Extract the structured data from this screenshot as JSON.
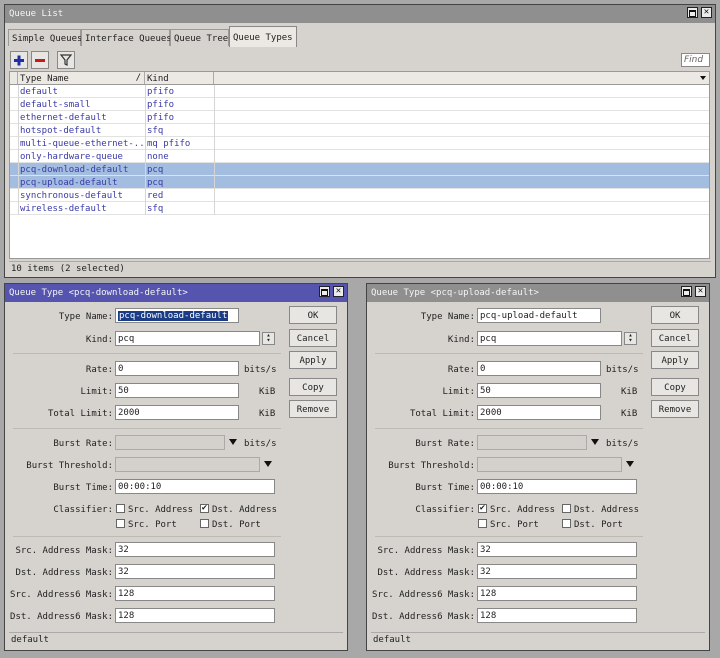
{
  "main": {
    "title": "Queue List",
    "tabs": [
      {
        "label": "Simple Queues"
      },
      {
        "label": "Interface Queues"
      },
      {
        "label": "Queue Tree"
      },
      {
        "label": "Queue Types"
      }
    ],
    "toolbar": {
      "add_icon": "plus-icon",
      "remove_icon": "minus-icon",
      "filter_icon": "filter-icon",
      "find_label": "Find"
    },
    "columns": {
      "name": "Type Name",
      "kind": "Kind"
    },
    "rows": [
      {
        "name": "default",
        "kind": "pfifo"
      },
      {
        "name": "default-small",
        "kind": "pfifo"
      },
      {
        "name": "ethernet-default",
        "kind": "pfifo"
      },
      {
        "name": "hotspot-default",
        "kind": "sfq"
      },
      {
        "name": "multi-queue-ethernet-...",
        "kind": "mq pfifo"
      },
      {
        "name": "only-hardware-queue",
        "kind": "none"
      },
      {
        "name": "pcq-download-default",
        "kind": "pcq"
      },
      {
        "name": "pcq-upload-default",
        "kind": "pcq"
      },
      {
        "name": "synchronous-default",
        "kind": "red"
      },
      {
        "name": "wireless-default",
        "kind": "sfq"
      }
    ],
    "status": "10 items (2 selected)"
  },
  "labels": {
    "type_name": "Type Name:",
    "kind": "Kind:",
    "rate": "Rate:",
    "limit": "Limit:",
    "total_limit": "Total Limit:",
    "burst_rate": "Burst Rate:",
    "burst_threshold": "Burst Threshold:",
    "burst_time": "Burst Time:",
    "classifier": "Classifier:",
    "src_address": "Src. Address",
    "dst_address": "Dst. Address",
    "src_port": "Src. Port",
    "dst_port": "Dst. Port",
    "src_mask": "Src. Address Mask:",
    "dst_mask": "Dst. Address Mask:",
    "src6_mask": "Src. Address6 Mask:",
    "dst6_mask": "Dst. Address6 Mask:",
    "unit_bits": "bits/s",
    "unit_kib": "KiB"
  },
  "buttons": {
    "ok": "OK",
    "cancel": "Cancel",
    "apply": "Apply",
    "copy": "Copy",
    "remove": "Remove"
  },
  "dl": {
    "title": "Queue Type <pcq-download-default>",
    "type_name": "pcq-download-default",
    "kind": "pcq",
    "rate": "0",
    "limit": "50",
    "total_limit": "2000",
    "burst_rate": "",
    "burst_threshold": "",
    "burst_time": "00:00:10",
    "src_address": false,
    "dst_address": true,
    "src_port": false,
    "dst_port": false,
    "src_mask": "32",
    "dst_mask": "32",
    "src6_mask": "128",
    "dst6_mask": "128",
    "status": "default"
  },
  "ul": {
    "title": "Queue Type <pcq-upload-default>",
    "type_name": "pcq-upload-default",
    "kind": "pcq",
    "rate": "0",
    "limit": "50",
    "total_limit": "2000",
    "burst_rate": "",
    "burst_threshold": "",
    "burst_time": "00:00:10",
    "src_address": true,
    "dst_address": false,
    "src_port": false,
    "dst_port": false,
    "src_mask": "32",
    "dst_mask": "32",
    "src6_mask": "128",
    "dst6_mask": "128",
    "status": "default"
  }
}
